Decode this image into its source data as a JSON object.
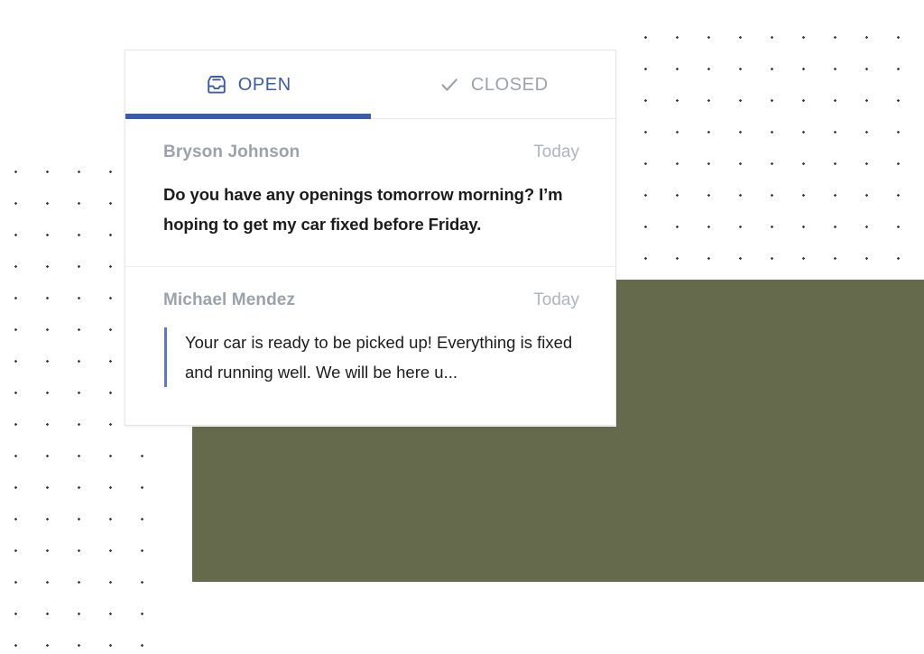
{
  "theme": {
    "accent_blue": "#3B5CA8",
    "quote_bar_blue": "#5E79BD",
    "muted_gray": "#9AA3AB",
    "olive_green": "#666A4C",
    "card_background": "#FFFFFF",
    "page_background": "#FFFFFF",
    "dot_color": "#3D3D3D"
  },
  "inbox": {
    "tabs": [
      {
        "id": "open",
        "label": "OPEN",
        "icon": "inbox-icon",
        "active": true
      },
      {
        "id": "closed",
        "label": "CLOSED",
        "icon": "check-icon",
        "active": false
      }
    ],
    "messages": [
      {
        "sender": "Bryson Johnson",
        "timestamp": "Today",
        "preview": "Do you have any openings tomorrow morning? I’m hoping to get my car fixed before Friday.",
        "style": "bold",
        "quoted": false
      },
      {
        "sender": "Michael Mendez",
        "timestamp": "Today",
        "preview": "Your car is ready to be picked up! Everything is fixed and running well. We will be here u...",
        "style": "regular",
        "quoted": true
      }
    ]
  }
}
